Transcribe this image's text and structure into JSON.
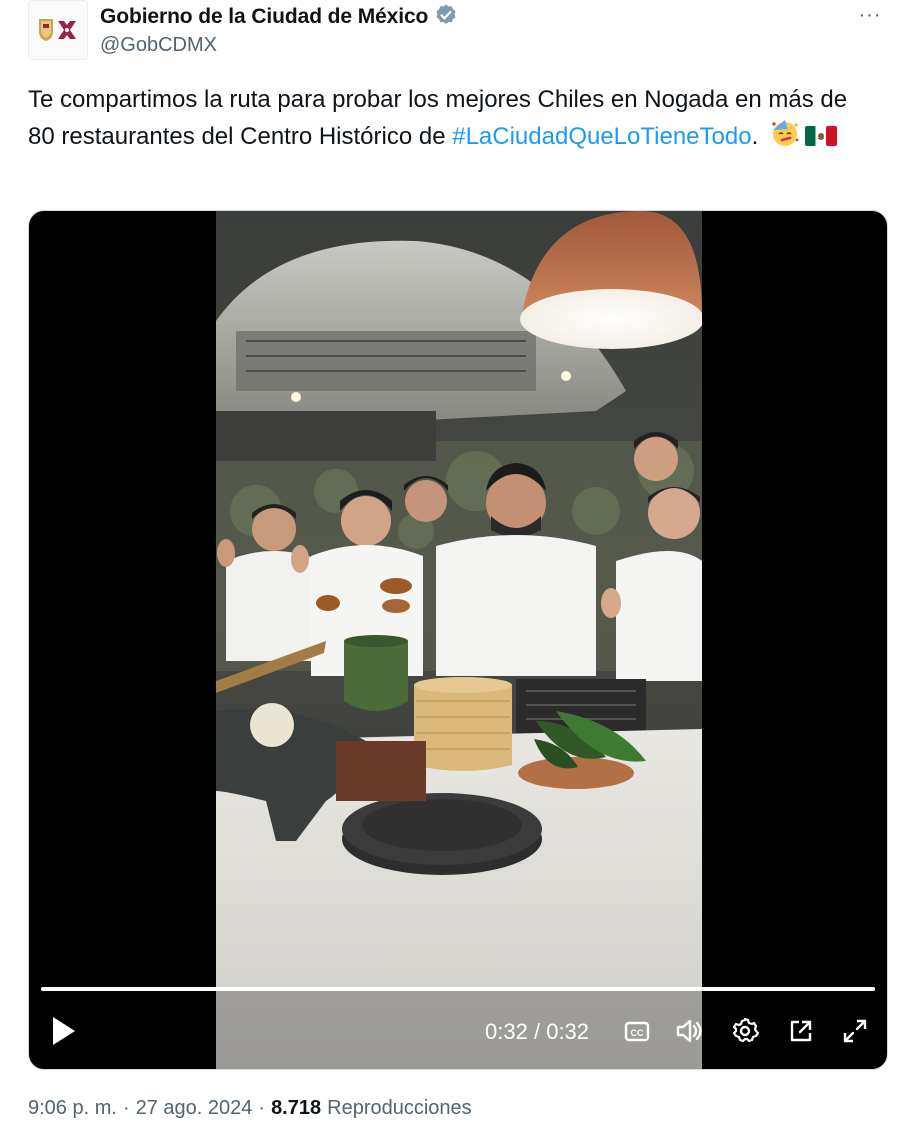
{
  "author": {
    "display_name": "Gobierno de la Ciudad de México",
    "handle": "@GobCDMX",
    "verified": true,
    "verified_color": "#829aab"
  },
  "more_icon": "more-horizontal-icon",
  "more_label": "···",
  "text": {
    "line1": "Te compartimos la ruta para probar los mejores Chiles en Nogada en más de 80 restaurantes del Centro Histórico de ",
    "hashtag": "#LaCiudadQueLoTieneTodo",
    "trail": ".",
    "emojis": [
      "party-face-emoji",
      "mexico-flag-emoji"
    ]
  },
  "video": {
    "current_time": "0:32",
    "separator": "/",
    "duration": "0:32",
    "progress": 1.0,
    "controls": [
      "play-icon",
      "captions-icon",
      "volume-icon",
      "settings-icon",
      "popout-icon",
      "fullscreen-icon"
    ]
  },
  "meta": {
    "time": "9:06 p. m.",
    "date": "27 ago. 2024",
    "separator": "·",
    "views": "8.718",
    "views_label": "Reproducciones"
  },
  "colors": {
    "link": "#1d9bf0",
    "text": "#0f1419",
    "secondary": "#536471"
  }
}
